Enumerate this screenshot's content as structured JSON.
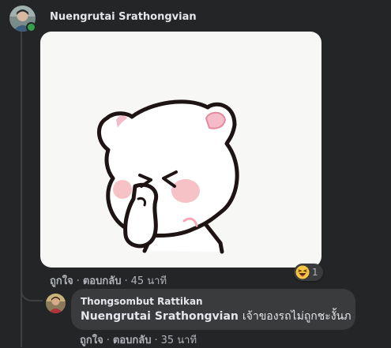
{
  "comment": {
    "author": "Nuengrutai Srathongvian",
    "actions": {
      "like": "ถูกใจ",
      "reply": "ตอบกลับ",
      "time": "45 นาที"
    },
    "reaction": {
      "icon": "haha-emoji-icon",
      "count": "1"
    }
  },
  "reply": {
    "author": "Thongsombut Rattikan",
    "mention": "Nuengrutai Srathongvian",
    "text": "เจ้าของรถไม่ถูกชะงั้นภ",
    "emoji": "sweat-smile-emoji-icon",
    "actions": {
      "like": "ถูกใจ",
      "reply": "ตอบกลับ",
      "time": "35 นาที"
    }
  },
  "colors": {
    "background": "#242526",
    "bubble": "#3a3b3c",
    "text": "#e4e6eb",
    "secondary_text": "#b0b3b8",
    "online": "#31a24c"
  }
}
